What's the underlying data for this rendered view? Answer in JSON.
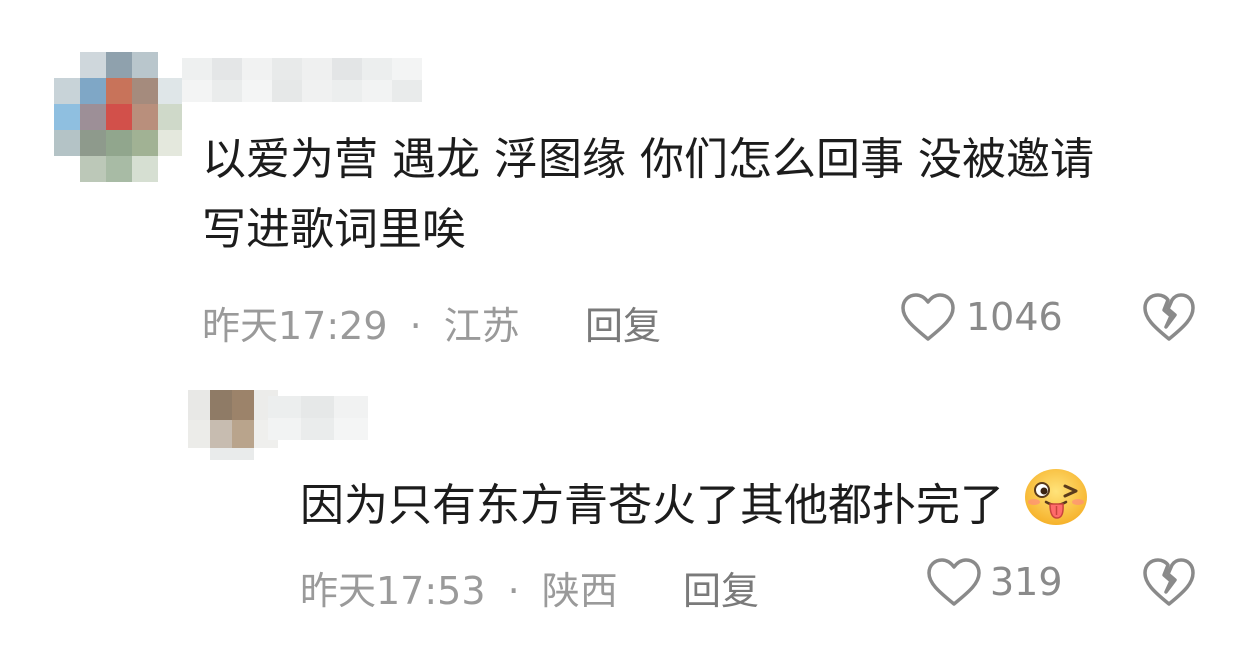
{
  "comments": [
    {
      "text_line1": "以爱为营 遇龙 浮图缘 你们怎么回事 没被邀请",
      "text_line2": "写进歌词里唉",
      "time": "昨天17:29",
      "location": "江苏",
      "reply_label": "回复",
      "likes": "1046"
    },
    {
      "text": "因为只有东方青苍火了其他都扑完了",
      "time": "昨天17:53",
      "location": "陕西",
      "reply_label": "回复",
      "likes": "319"
    }
  ],
  "separator": "·",
  "icons": {
    "like": "heart-outline-icon",
    "dislike": "broken-heart-icon",
    "emoji": "wink-tongue-emoji"
  },
  "colors": {
    "text": "#1c1c1c",
    "meta": "#9a9a9a",
    "icon": "#8a8a8a"
  }
}
